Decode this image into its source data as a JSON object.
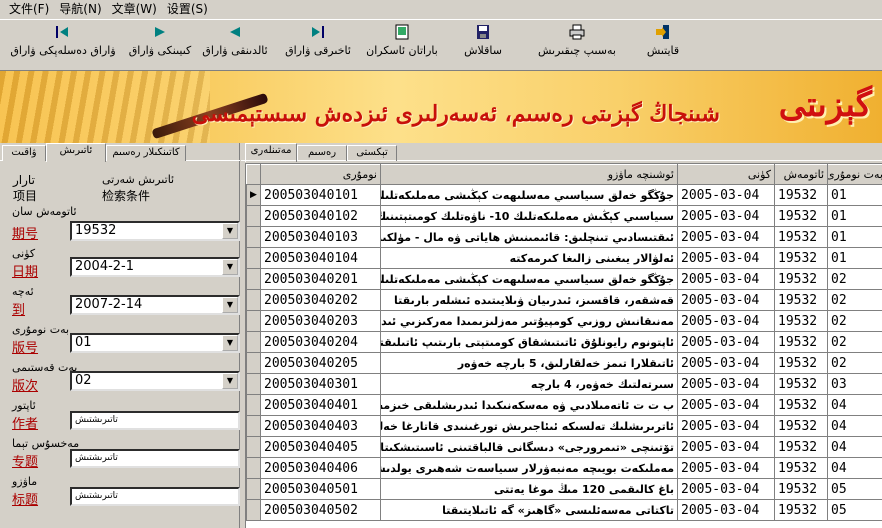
{
  "menu": [
    "文件(F)",
    "导航(N)",
    "文章(W)",
    "设置(S)"
  ],
  "toolbar": [
    {
      "label": "ۋاراق دەسلەپكى ۋاراق",
      "icon": "first-page-icon"
    },
    {
      "label": "كىيىنكى ۋاراق",
      "icon": "next-page-icon"
    },
    {
      "label": "ئالدىنقى ۋاراق",
      "icon": "prev-page-icon"
    },
    {
      "label": "ئاخىرقى ۋاراق",
      "icon": "last-page-icon"
    },
    {
      "label": "باراتان ئاسكران",
      "icon": "screen-icon"
    },
    {
      "label": "ساقلاش",
      "icon": "save-icon"
    },
    {
      "label": "بەسىپ چىقىرىش",
      "icon": "print-icon"
    },
    {
      "label": "قايتىش",
      "icon": "exit-icon"
    }
  ],
  "banner": {
    "slogan": "شىنجاڭ گېزىتى رەسىم، ئەسەرلىرى ئىزدەش سىستېمىسى",
    "logo": "گېزىتى"
  },
  "left_tabs": [
    "ۋاقىت",
    "ئاتىرىش",
    "كاتىنكىلار رەسىم"
  ],
  "conditions": {
    "ug_title": "ئاتىرىش شەرتى",
    "zh_title1": "تارار",
    "zh_title2": "项目",
    "zh_title3": "检索条件"
  },
  "fields": {
    "issue_ug": "ئاتومەش سان",
    "issue_zh": "期号",
    "issue_value": "19532",
    "date_ug": "كۈنى",
    "date_zh": "日期",
    "date_value": "2004-2-1",
    "to_ug": "ئەچە",
    "to_zh": "到",
    "to_value": "2007-2-14",
    "page_ug": "بەت نومۇرى",
    "page_zh": "版号",
    "page_value": "01",
    "edition_ug": "بەت قەستىمى",
    "edition_zh": "版次",
    "edition_value": "02",
    "author_ug": "ئاپتور",
    "author_zh": "作者",
    "author_value": "تاتىرىشتىش",
    "topic_ug": "مەخسۇس تېما",
    "topic_zh": "专题",
    "topic_value": "تاتىرىشتىش",
    "title_ug": "ماۋزو",
    "title_zh": "标题",
    "title_value": "تاتىرىشتىش"
  },
  "right_tabs": [
    "تېكستى",
    "رەسىم",
    "مەتىنلەرى"
  ],
  "table": {
    "headers": [
      "نومۇرى",
      "ئوشىنچە ماۋزو",
      "كۈنى",
      "ئاتومەش",
      "بەت نومۇرى"
    ],
    "rows": [
      [
        "200503040101",
        "جۇڭگو خەلق سىياسىي مەسلىھەت كېڭىشى مەملىكەتلىك 10-",
        "2005-03-04",
        "19532",
        "01"
      ],
      [
        "200503040102",
        "سىياسىي كېڭىش مەملىكەتلىك 10- ناۋەتلىك كومىتېتىنىڭ",
        "2005-03-04",
        "19532",
        "01"
      ],
      [
        "200503040103",
        "ئىقتىسادىي تىنچلىق: قائىمىنىش ھاياتى ۋە مال - مۈلكىنى",
        "2005-03-04",
        "19532",
        "01"
      ],
      [
        "200503040104",
        "ئەلۋالار يىغىنى زالىغا كىرمەكتە",
        "2005-03-04",
        "19532",
        "01"
      ],
      [
        "200503040201",
        "جۇڭگو خەلق سىياسىي مەسلىھەت كېڭىشى مەملىكەتلىك",
        "2005-03-04",
        "19532",
        "02"
      ],
      [
        "200503040202",
        "قەشقەر، قاقسىز، ئىدرىيان ۋىلايىتىدە ئىشلەر بارىقتا",
        "2005-03-04",
        "19532",
        "02"
      ],
      [
        "200503040203",
        "مەنىقانىش روزىي كومپيۇتىر مەزلىزىمىدا مەركىزىي ئىدرىپ، ج",
        "2005-03-04",
        "19532",
        "02"
      ],
      [
        "200503040204",
        "ئاپتونوم رايونلۇق ئاتىتىشقاق كومىتېتى بارىتىپ ئاتىلىقتا",
        "2005-03-04",
        "19532",
        "02"
      ],
      [
        "200503040205",
        "ئاتىقلارا تىمز خەلقارلىق، 5 بارچە خەۋەر",
        "2005-03-04",
        "19532",
        "02"
      ],
      [
        "200503040301",
        "سىرتەلتىك خەۋەر، 4 بارچە",
        "2005-03-04",
        "19532",
        "03"
      ],
      [
        "200503040401",
        "ب ت ت ئاتەمىلادىي ۋە مەسكەنىكىدا ئىدرىشلىقى خىزمەتچى خادىم",
        "2005-03-04",
        "19532",
        "04"
      ],
      [
        "200503040403",
        "ئاترىرىشلىك تەلسىكە ئىئاجىرىش تورغىنىدى قاتارغا خەلق ئاپ",
        "2005-03-04",
        "19532",
        "04"
      ],
      [
        "200503040405",
        "تۆتىنچى «تىمرورجى» دىسگانى قالباقتىنى ئاسىتىشكىتا ئاتالا",
        "2005-03-04",
        "19532",
        "04"
      ],
      [
        "200503040406",
        "مەملىكەت بويىچە مەنبەۋرلار سىياسەت شەھىرى يولدىشى",
        "2005-03-04",
        "19532",
        "04"
      ],
      [
        "200503040501",
        "باغ كالىقمى 120 مىڭ موغا يەتتى",
        "2005-03-04",
        "19532",
        "05"
      ],
      [
        "200503040502",
        "تاكتاتى مەسەئلىسى «گاھىز» گە ئاتىلايتىقتا",
        "2005-03-04",
        "19532",
        "05"
      ]
    ]
  }
}
